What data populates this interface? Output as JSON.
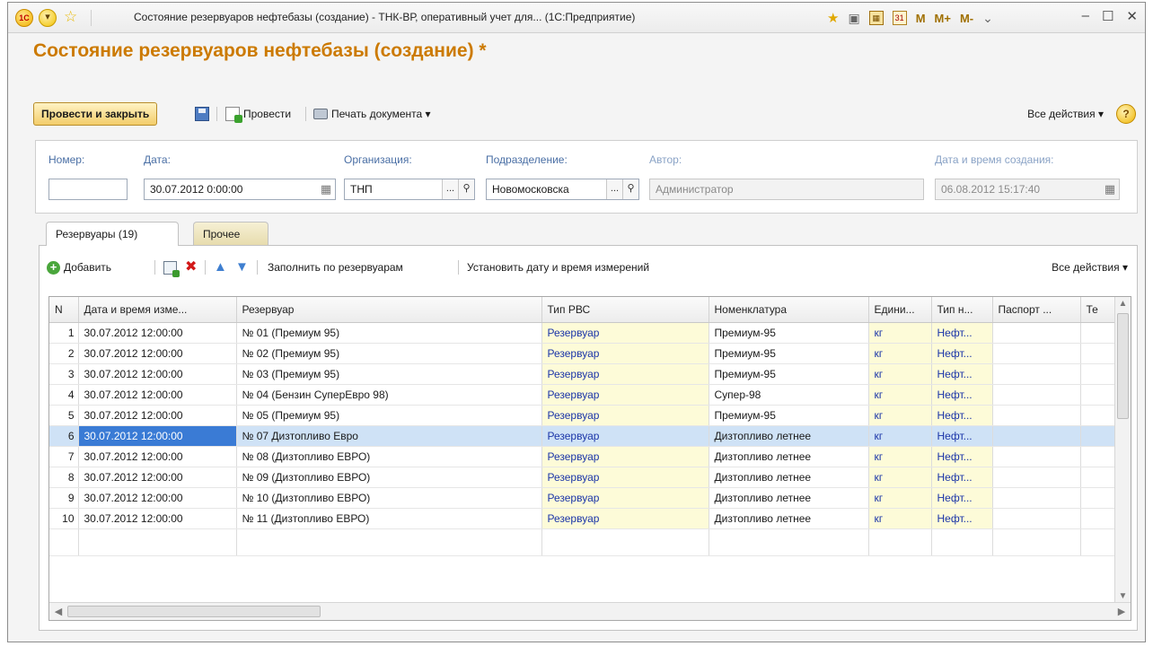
{
  "titlebar": {
    "logo": "1С",
    "title": "Состояние резервуаров нефтебазы (создание) - ТНК-ВР, оперативный учет для...  (1С:Предприятие)",
    "m": "M",
    "mplus": "M+",
    "mminus": "M-",
    "minimize": "‒",
    "maximize": "☐",
    "close": "✕"
  },
  "doc": {
    "title": "Состояние резервуаров нефтебазы (создание) *"
  },
  "toolbar": {
    "post_close": "Провести и закрыть",
    "post": "Провести",
    "print": "Печать документа ▾",
    "all_actions": "Все действия ▾",
    "help": "?"
  },
  "fields": {
    "number_label": "Номер:",
    "number_value": "",
    "date_label": "Дата:",
    "date_value": "30.07.2012  0:00:00",
    "org_label": "Организация:",
    "org_value": "ТНП",
    "dept_label": "Подразделение:",
    "dept_value": "Новомосковска",
    "author_label": "Автор:",
    "author_value": "Администратор",
    "created_label": "Дата и время создания:",
    "created_value": "06.08.2012 15:17:40"
  },
  "tabs": [
    {
      "label": "Резервуары (19)"
    },
    {
      "label": "Прочее"
    }
  ],
  "grid_toolbar": {
    "add": "Добавить",
    "fill": "Заполнить по резервуарам",
    "set_datetime": "Установить дату и время измерений",
    "all_actions": "Все действия ▾"
  },
  "table": {
    "columns": [
      "N",
      "Дата и время изме...",
      "Резервуар",
      "Тип РВС",
      "Номенклатура",
      "Едини...",
      "Тип н...",
      "Паспорт ...",
      "Те"
    ],
    "rows": [
      {
        "n": "1",
        "dt": "30.07.2012 12:00:00",
        "tank": "№ 01 (Премиум 95)",
        "type": "Резервуар",
        "nom": "Премиум-95",
        "unit": "кг",
        "ptype": "Нефт..."
      },
      {
        "n": "2",
        "dt": "30.07.2012 12:00:00",
        "tank": "№ 02 (Премиум 95)",
        "type": "Резервуар",
        "nom": "Премиум-95",
        "unit": "кг",
        "ptype": "Нефт..."
      },
      {
        "n": "3",
        "dt": "30.07.2012 12:00:00",
        "tank": "№ 03 (Премиум 95)",
        "type": "Резервуар",
        "nom": "Премиум-95",
        "unit": "кг",
        "ptype": "Нефт..."
      },
      {
        "n": "4",
        "dt": "30.07.2012 12:00:00",
        "tank": "№ 04 (Бензин СуперЕвро 98)",
        "type": "Резервуар",
        "nom": "Супер-98",
        "unit": "кг",
        "ptype": "Нефт..."
      },
      {
        "n": "5",
        "dt": "30.07.2012 12:00:00",
        "tank": "№ 05 (Премиум 95)",
        "type": "Резервуар",
        "nom": "Премиум-95",
        "unit": "кг",
        "ptype": "Нефт..."
      },
      {
        "n": "6",
        "dt": "30.07.2012 12:00:00",
        "tank": "№ 07 Дизтопливо Евро",
        "type": "Резервуар",
        "nom": "Дизтопливо летнее",
        "unit": "кг",
        "ptype": "Нефт..."
      },
      {
        "n": "7",
        "dt": "30.07.2012 12:00:00",
        "tank": "№ 08 (Дизтопливо ЕВРО)",
        "type": "Резервуар",
        "nom": "Дизтопливо летнее",
        "unit": "кг",
        "ptype": "Нефт..."
      },
      {
        "n": "8",
        "dt": "30.07.2012 12:00:00",
        "tank": "№ 09 (Дизтопливо ЕВРО)",
        "type": "Резервуар",
        "nom": "Дизтопливо летнее",
        "unit": "кг",
        "ptype": "Нефт..."
      },
      {
        "n": "9",
        "dt": "30.07.2012 12:00:00",
        "tank": "№ 10 (Дизтопливо ЕВРО)",
        "type": "Резервуар",
        "nom": "Дизтопливо летнее",
        "unit": "кг",
        "ptype": "Нефт..."
      },
      {
        "n": "10",
        "dt": "30.07.2012 12:00:00",
        "tank": "№ 11 (Дизтопливо ЕВРО)",
        "type": "Резервуар",
        "nom": "Дизтопливо летнее",
        "unit": "кг",
        "ptype": "Нефт..."
      }
    ],
    "selected_row": 6
  },
  "colors": {
    "title_orange": "#cc7a00",
    "label_blue": "#4a6fa5",
    "yellow_cell": "#fdfbd8",
    "selection": "#cfe2f6",
    "current_cell": "#3a7bd5"
  }
}
